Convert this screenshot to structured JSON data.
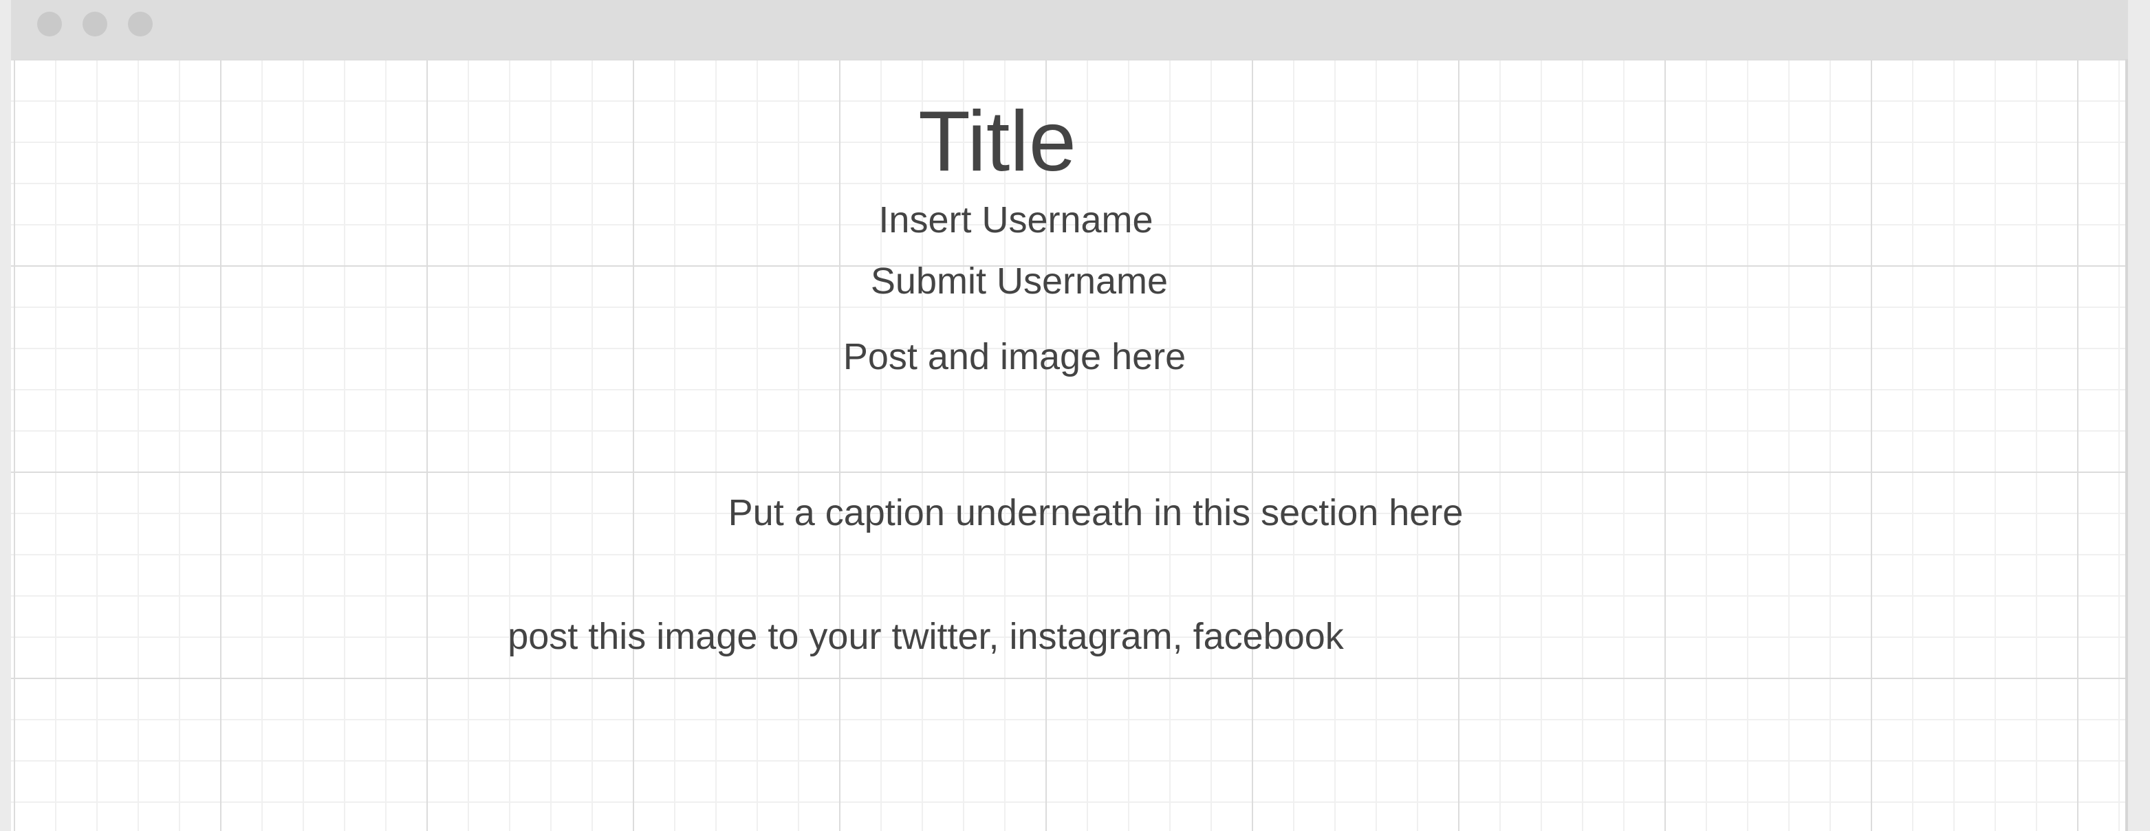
{
  "window": {
    "controls": [
      "window-control-dot",
      "window-control-dot",
      "window-control-dot"
    ]
  },
  "content": {
    "title": "Title",
    "insert_username": "Insert Username",
    "submit_username": "Submit Username",
    "post_image": "Post and image here",
    "caption": "Put a caption underneath in this section here",
    "share": "post this image to your twitter, instagram, facebook"
  },
  "colors": {
    "text": "#444444",
    "titlebar": "#dddddd",
    "grid_major": "#dcdcdc",
    "grid_minor": "#f0f0f0",
    "background": "#ffffff"
  }
}
